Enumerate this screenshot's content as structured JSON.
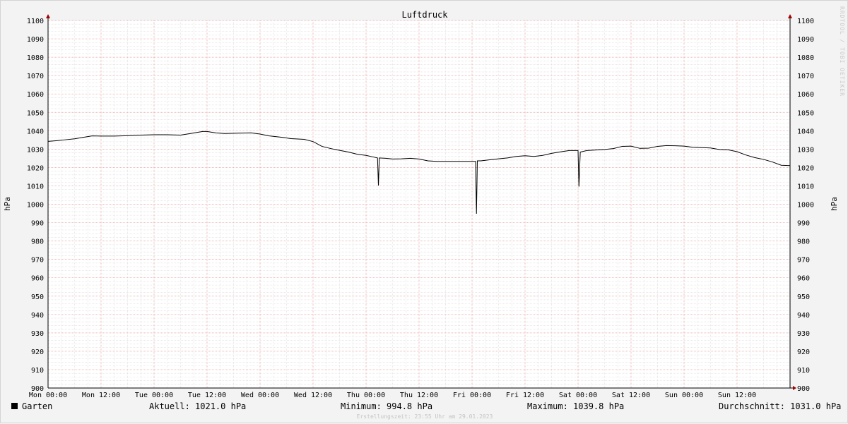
{
  "chart_data": {
    "type": "line",
    "title": "Luftdruck",
    "ylabel": "hPa",
    "ylabel_right": "hPa",
    "ylim": [
      900,
      1100
    ],
    "y_ticks": [
      900,
      910,
      920,
      930,
      940,
      950,
      960,
      970,
      980,
      990,
      1000,
      1010,
      1020,
      1030,
      1040,
      1050,
      1060,
      1070,
      1080,
      1090,
      1100
    ],
    "xlim_hours": [
      0,
      168
    ],
    "x_ticks": [
      {
        "hours": 0,
        "label": "Mon 00:00"
      },
      {
        "hours": 12,
        "label": "Mon 12:00"
      },
      {
        "hours": 24,
        "label": "Tue 00:00"
      },
      {
        "hours": 36,
        "label": "Tue 12:00"
      },
      {
        "hours": 48,
        "label": "Wed 00:00"
      },
      {
        "hours": 60,
        "label": "Wed 12:00"
      },
      {
        "hours": 72,
        "label": "Thu 00:00"
      },
      {
        "hours": 84,
        "label": "Thu 12:00"
      },
      {
        "hours": 96,
        "label": "Fri 00:00"
      },
      {
        "hours": 108,
        "label": "Fri 12:00"
      },
      {
        "hours": 120,
        "label": "Sat 00:00"
      },
      {
        "hours": 132,
        "label": "Sat 12:00"
      },
      {
        "hours": 144,
        "label": "Sun 00:00"
      },
      {
        "hours": 156,
        "label": "Sun 12:00"
      }
    ],
    "grid": true,
    "series": [
      {
        "name": "Garten",
        "color": "#000000",
        "points": [
          [
            0,
            1034.2
          ],
          [
            2,
            1034.6
          ],
          [
            4,
            1035.1
          ],
          [
            6,
            1035.6
          ],
          [
            8,
            1036.4
          ],
          [
            10,
            1037.2
          ],
          [
            12,
            1037.1
          ],
          [
            15,
            1037.1
          ],
          [
            18,
            1037.3
          ],
          [
            21,
            1037.6
          ],
          [
            24,
            1037.8
          ],
          [
            27,
            1037.8
          ],
          [
            30,
            1037.6
          ],
          [
            32,
            1038.4
          ],
          [
            35,
            1039.6
          ],
          [
            36,
            1039.6
          ],
          [
            38,
            1038.8
          ],
          [
            40,
            1038.5
          ],
          [
            43,
            1038.7
          ],
          [
            46,
            1038.8
          ],
          [
            48,
            1038.2
          ],
          [
            50,
            1037.2
          ],
          [
            53,
            1036.4
          ],
          [
            55,
            1035.7
          ],
          [
            58,
            1035.3
          ],
          [
            60,
            1034.1
          ],
          [
            62,
            1031.5
          ],
          [
            64,
            1030.3
          ],
          [
            66,
            1029.3
          ],
          [
            68,
            1028.4
          ],
          [
            70,
            1027.2
          ],
          [
            72,
            1026.6
          ],
          [
            74,
            1025.5
          ],
          [
            74.6,
            1025.2
          ],
          [
            74.8,
            1010.2
          ],
          [
            75,
            1025.2
          ],
          [
            76.5,
            1025.0
          ],
          [
            78,
            1024.6
          ],
          [
            80,
            1024.7
          ],
          [
            82,
            1025.0
          ],
          [
            84,
            1024.6
          ],
          [
            86,
            1023.6
          ],
          [
            88,
            1023.3
          ],
          [
            90,
            1023.3
          ],
          [
            92,
            1023.3
          ],
          [
            94,
            1023.3
          ],
          [
            96,
            1023.3
          ],
          [
            96.8,
            1023.3
          ],
          [
            97.0,
            994.8
          ],
          [
            97.2,
            1023.6
          ],
          [
            98,
            1023.6
          ],
          [
            100,
            1024.2
          ],
          [
            102,
            1024.7
          ],
          [
            104,
            1025.2
          ],
          [
            106,
            1026.0
          ],
          [
            108,
            1026.4
          ],
          [
            110,
            1026.0
          ],
          [
            112,
            1026.6
          ],
          [
            114,
            1027.7
          ],
          [
            116,
            1028.5
          ],
          [
            118,
            1029.2
          ],
          [
            120,
            1029.2
          ],
          [
            120.2,
            1009.6
          ],
          [
            120.5,
            1028.4
          ],
          [
            122,
            1029.2
          ],
          [
            124,
            1029.5
          ],
          [
            126,
            1029.8
          ],
          [
            128,
            1030.3
          ],
          [
            130,
            1031.5
          ],
          [
            132,
            1031.6
          ],
          [
            134,
            1030.4
          ],
          [
            136,
            1030.5
          ],
          [
            138,
            1031.5
          ],
          [
            140,
            1031.9
          ],
          [
            142,
            1031.8
          ],
          [
            144,
            1031.6
          ],
          [
            146,
            1031.0
          ],
          [
            148,
            1030.8
          ],
          [
            150,
            1030.6
          ],
          [
            152,
            1029.8
          ],
          [
            154,
            1029.6
          ],
          [
            156,
            1028.6
          ],
          [
            158,
            1026.8
          ],
          [
            160,
            1025.4
          ],
          [
            162,
            1024.4
          ],
          [
            164,
            1023.0
          ],
          [
            166,
            1021.2
          ],
          [
            168,
            1021.0
          ]
        ]
      }
    ]
  },
  "legend": {
    "series_name": "Garten",
    "current": "Aktuell: 1021.0 hPa",
    "minimum": "Minimum: 994.8 hPa",
    "maximum": "Maximum: 1039.8 hPa",
    "average": "Durchschnitt: 1031.0 hPa"
  },
  "footer": "Erstellungszeit: 23:55 Uhr am 29.01.2023",
  "watermark": "RRDTOOL / TOBI OETIKER"
}
